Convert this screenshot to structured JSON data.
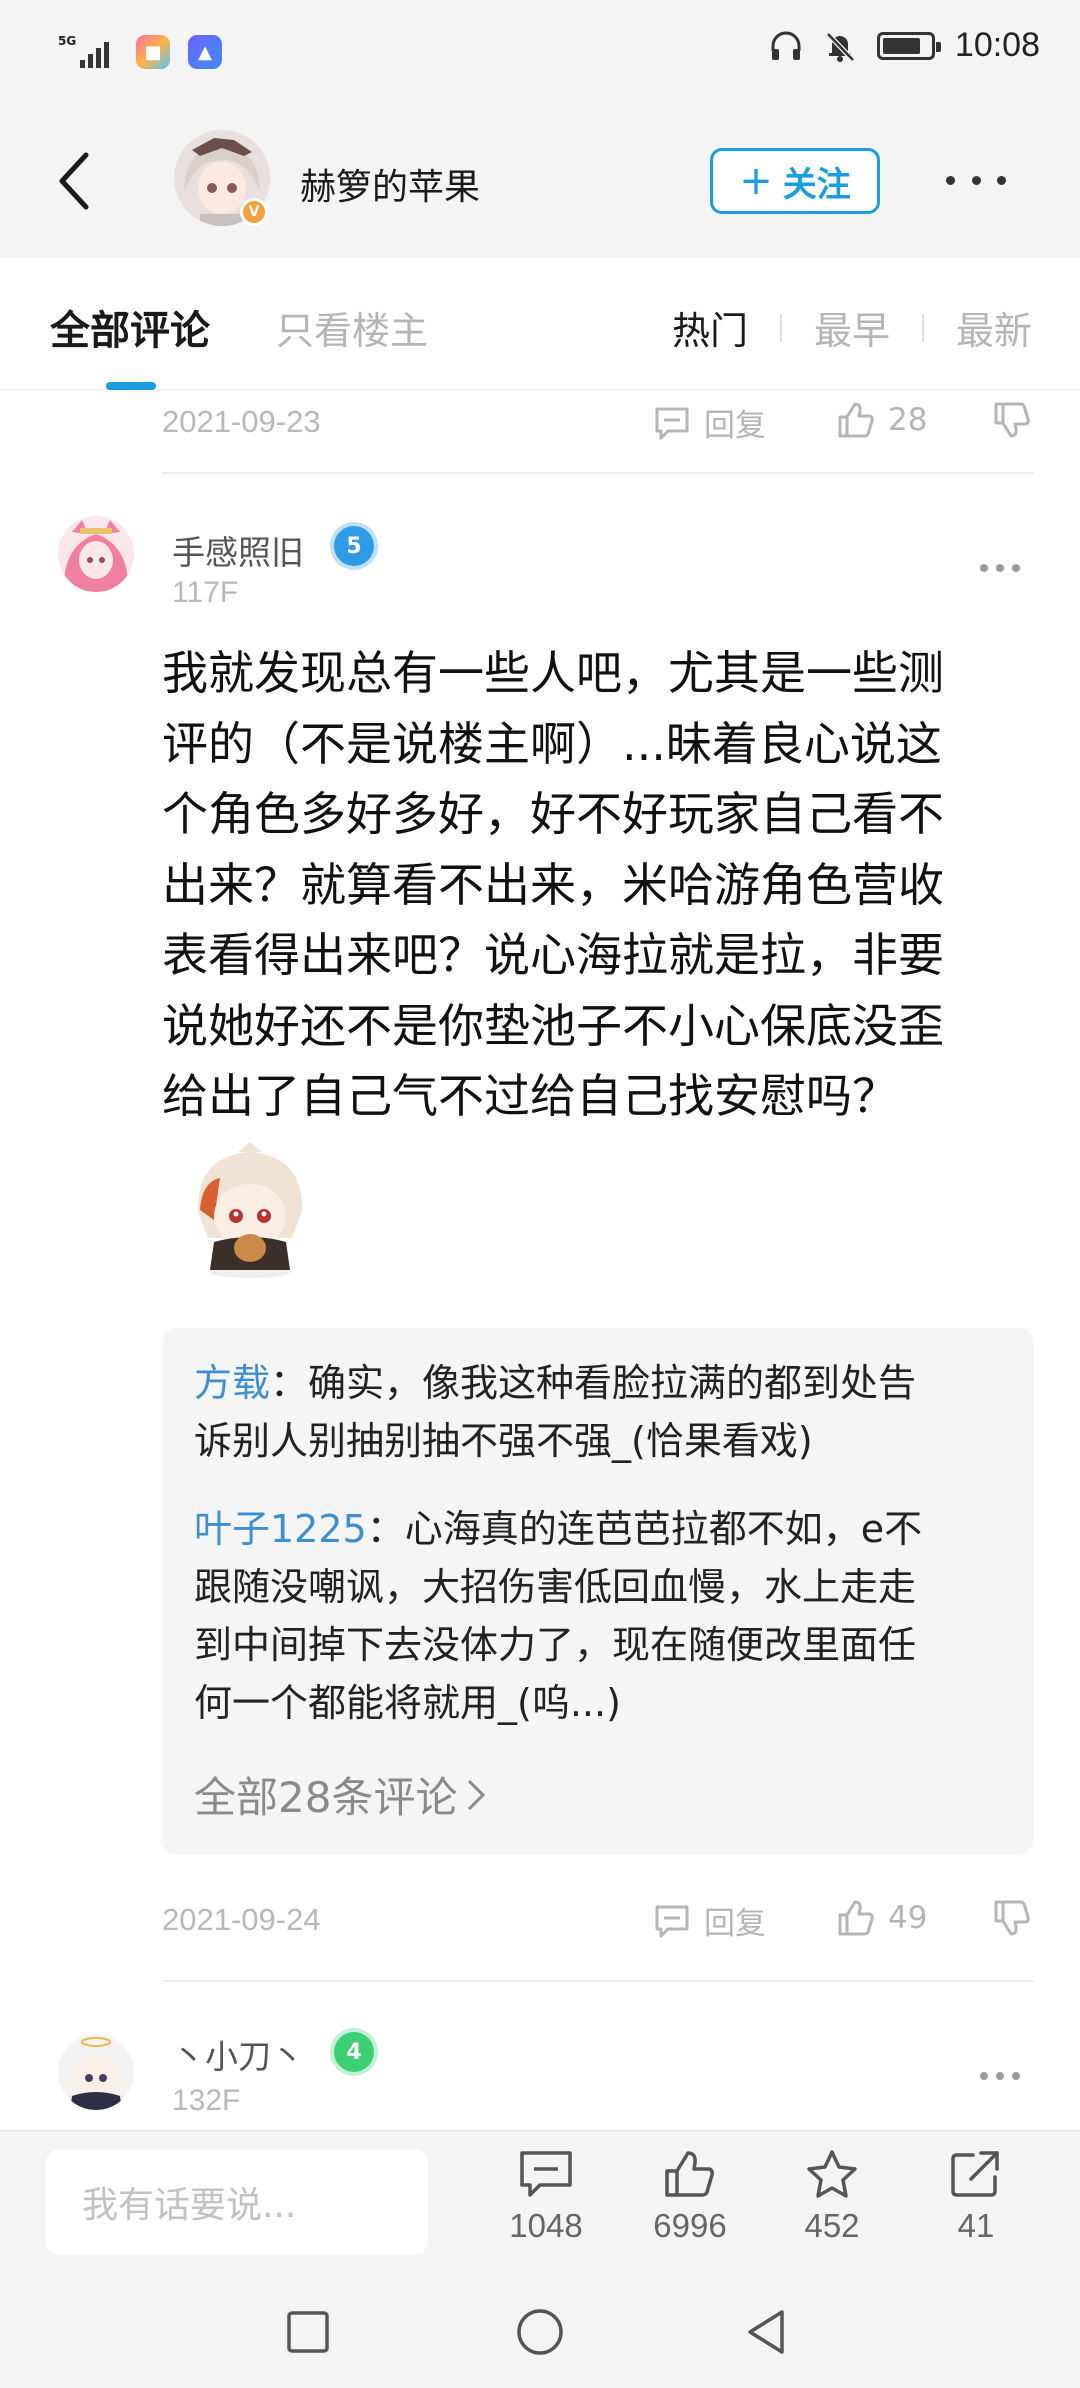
{
  "status_bar": {
    "network": "5G",
    "time": "10:08",
    "battery_level": 0.8
  },
  "header": {
    "author_name": "赫箩的苹果",
    "follow_label": "关注",
    "follow_plus": "+",
    "verified_badge": "V"
  },
  "tabs": {
    "all_comments": "全部评论",
    "owner_only": "只看楼主",
    "sort": [
      "热门",
      "最早",
      "最新"
    ],
    "active_sort": "热门"
  },
  "prev_comment": {
    "date": "2021-09-23",
    "reply_label": "回复",
    "likes": "28"
  },
  "comment": {
    "username": "手感照旧",
    "level": "5",
    "floor": "117F",
    "text_lines": [
      "我就发现总有一些人吧，尤其是一些测",
      "评的（不是说楼主啊）...昧着良心说这",
      "个角色多好多好，好不好玩家自己看不",
      "出来？就算看不出来，米哈游角色营收",
      "表看得出来吧？说心海拉就是拉，非要",
      "说她好还不是你垫池子不小心保底没歪",
      "给出了自己气不过给自己找安慰吗？"
    ],
    "sub_replies": [
      {
        "author": "方载",
        "line1": "：确实，像我这种看脸拉满的都到处告",
        "line2": "诉别人别抽别抽不强不强_(恰果看戏)"
      },
      {
        "author": "叶子1225",
        "line1": "：心海真的连芭芭拉都不如，e不",
        "line2": "跟随没嘲讽，大招伤害低回血慢，水上走走",
        "line3": "到中间掉下去没体力了，现在随便改里面任",
        "line4": "何一个都能将就用_(呜...)"
      }
    ],
    "all_replies_label": "全部28条评论",
    "date": "2021-09-24",
    "reply_label": "回复",
    "likes": "49"
  },
  "next_comment": {
    "username": "丶小刀丶",
    "level": "4",
    "floor": "132F"
  },
  "bottom_bar": {
    "input_placeholder": "我有话要说...",
    "comments_count": "1048",
    "likes_count": "6996",
    "favorites_count": "452",
    "shares_count": "41"
  },
  "colors": {
    "accent": "#1a9ee0",
    "reply_author": "#3d8fd1",
    "level5": "#2f9be6",
    "level4": "#3ccf73"
  }
}
